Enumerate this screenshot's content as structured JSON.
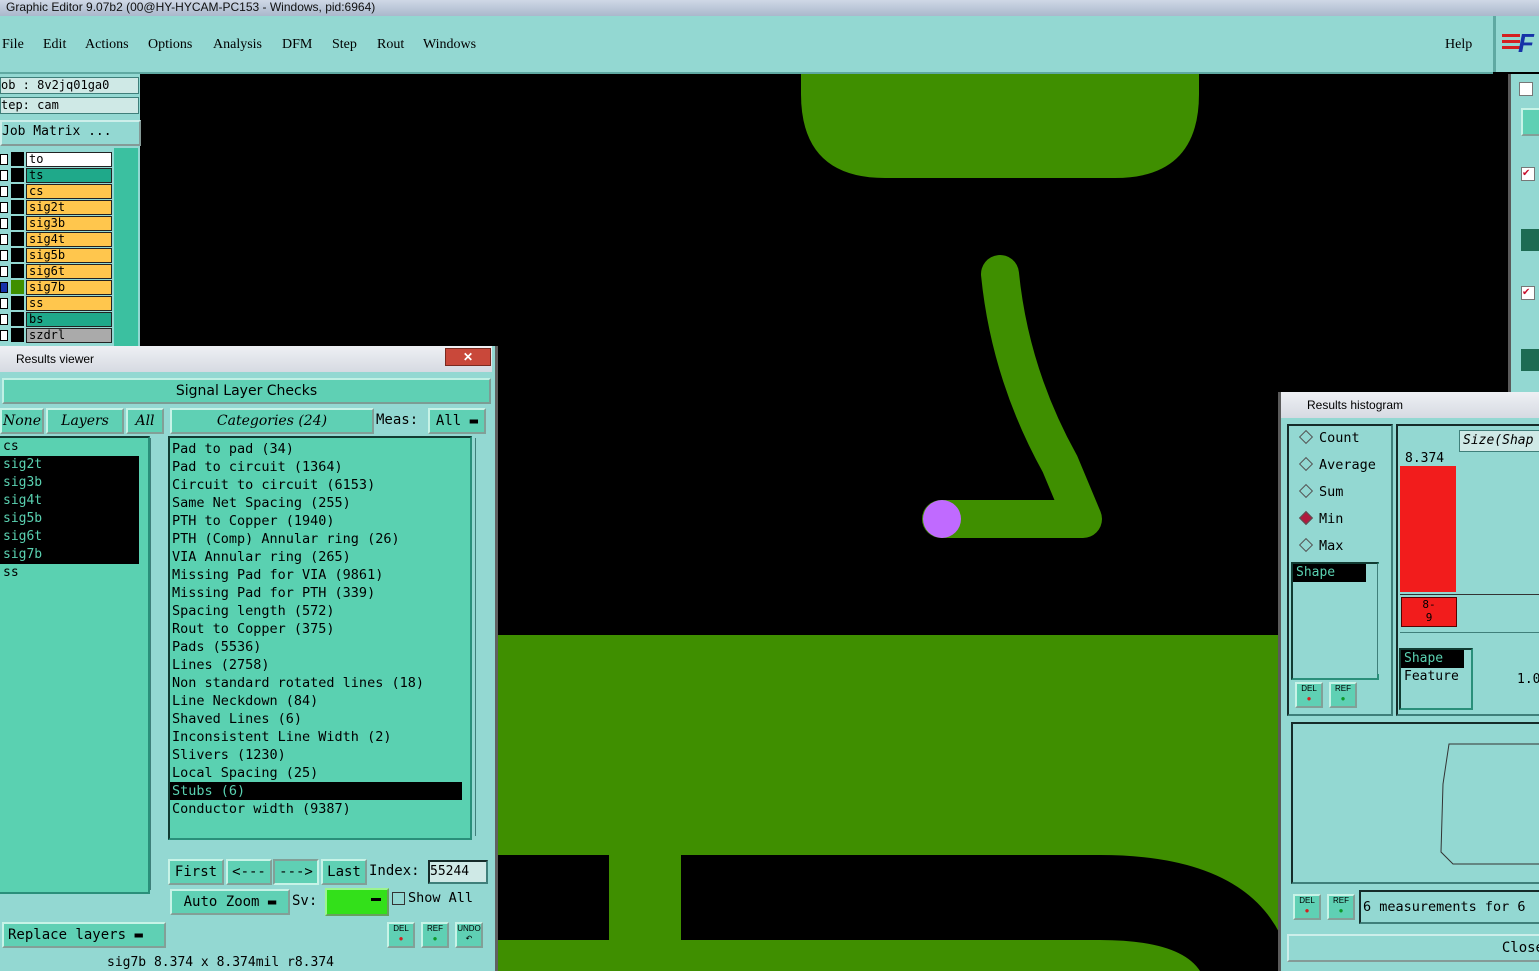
{
  "window": {
    "title": "Graphic Editor 9.07b2 (00@HY-HYCAM-PC153 - Windows, pid:6964)"
  },
  "menu": {
    "items": [
      "File",
      "Edit",
      "Actions",
      "Options",
      "Analysis",
      "DFM",
      "Step",
      "Rout",
      "Windows"
    ],
    "help": "Help"
  },
  "left_panel": {
    "job": "ob : 8v2jq01ga0",
    "step": "tep: cam",
    "job_matrix": "Job Matrix ...",
    "layers": [
      {
        "name": "to",
        "color": "#ffffff"
      },
      {
        "name": "ts",
        "color": "#1fa98a"
      },
      {
        "name": "cs",
        "color": "#ffc64d"
      },
      {
        "name": "sig2t",
        "color": "#ffc64d"
      },
      {
        "name": "sig3b",
        "color": "#ffc64d"
      },
      {
        "name": "sig4t",
        "color": "#ffc64d"
      },
      {
        "name": "sig5b",
        "color": "#ffc64d"
      },
      {
        "name": "sig6t",
        "color": "#ffc64d"
      },
      {
        "name": "sig7b",
        "color": "#ffc64d"
      },
      {
        "name": "ss",
        "color": "#ffc64d"
      },
      {
        "name": "bs",
        "color": "#1fa98a"
      },
      {
        "name": "szdrl",
        "color": "#aaaaaa"
      }
    ]
  },
  "results_viewer": {
    "title": "Results viewer",
    "close": "✕",
    "header": "Signal Layer Checks",
    "btn_none": "None",
    "btn_layers": "Layers",
    "btn_all": "All",
    "categories_btn": "Categories (24)",
    "meas_label": "Meas:",
    "meas_value": "All",
    "layers": [
      "cs",
      "sig2t",
      "sig3b",
      "sig4t",
      "sig5b",
      "sig6t",
      "sig7b",
      "ss"
    ],
    "categories": [
      "Pad to pad (34)",
      "Pad to circuit (1364)",
      "Circuit to circuit (6153)",
      "Same Net Spacing (255)",
      "PTH to Copper (1940)",
      "PTH (Comp) Annular ring (26)",
      "VIA Annular ring (265)",
      "Missing Pad for VIA (9861)",
      "Missing Pad for PTH (339)",
      "Spacing length (572)",
      "Rout to Copper (375)",
      "Pads (5536)",
      "Lines (2758)",
      "Non standard rotated lines (18)",
      "Line Neckdown (84)",
      "Shaved Lines (6)",
      "Inconsistent Line Width (2)",
      "Slivers (1230)",
      "Local Spacing (25)",
      "Stubs (6)",
      "Conductor width (9387)"
    ],
    "selected_category": "Stubs (6)",
    "nav": {
      "first": "First",
      "prev": "<---",
      "next": "--->",
      "last": "Last",
      "index_label": "Index:",
      "index_value": "55244"
    },
    "auto_zoom": "Auto Zoom",
    "sv_label": "Sv:",
    "show_all": "Show All",
    "replace_layers": "Replace layers",
    "del": "DEL",
    "ref": "REF",
    "undo": "UNDO"
  },
  "status_bar": {
    "text": "sig7b 8.374 x 8.374mil  r8.374"
  },
  "histogram": {
    "title": "Results histogram",
    "modes": [
      "Count",
      "Average",
      "Sum",
      "Min",
      "Max"
    ],
    "selected_mode": "Min",
    "list_item": "Shape",
    "size_label": "Size(Shap",
    "bar_value": "8.374",
    "bar_fill": 1.0,
    "bin_label_top": "8-",
    "bin_label_bottom": "9",
    "bar_color": "#f21c1c",
    "list2": [
      "Shape",
      "Feature"
    ],
    "scale_value": "1.0",
    "measurements": "6 measurements for 6",
    "close": "Close"
  },
  "colors": {
    "copper": "#3f8f00",
    "highlight": "#c06aff",
    "accent": "#93d8d2"
  }
}
